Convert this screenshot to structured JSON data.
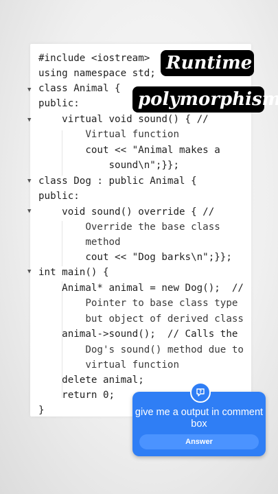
{
  "overlay": {
    "title_line1": "Runtime",
    "title_line2": "polymorphism"
  },
  "code": {
    "lines": [
      "#include <iostream>",
      "using namespace std;",
      "class Animal {",
      "public:",
      "    virtual void sound() { //",
      "        Virtual function",
      "        cout << \"Animal makes a",
      "            sound\\n\";}};",
      "class Dog : public Animal {",
      "public:",
      "    void sound() override { //",
      "        Override the base class",
      "        method",
      "        cout << \"Dog barks\\n\";}};",
      "int main() {",
      "    Animal* animal = new Dog();  //",
      "        Pointer to base class type",
      "        but object of derived class",
      "    animal->sound();  // Calls the",
      "        Dog's sound() method due to",
      "        virtual function",
      "    delete animal;",
      "    return 0;",
      "}"
    ]
  },
  "comment_prompt": {
    "icon": "question-bubble-icon",
    "text": "give me a output in comment box",
    "answer_label": "Answer"
  },
  "colors": {
    "accent": "#2f7ef5",
    "title_bg": "#000000"
  }
}
